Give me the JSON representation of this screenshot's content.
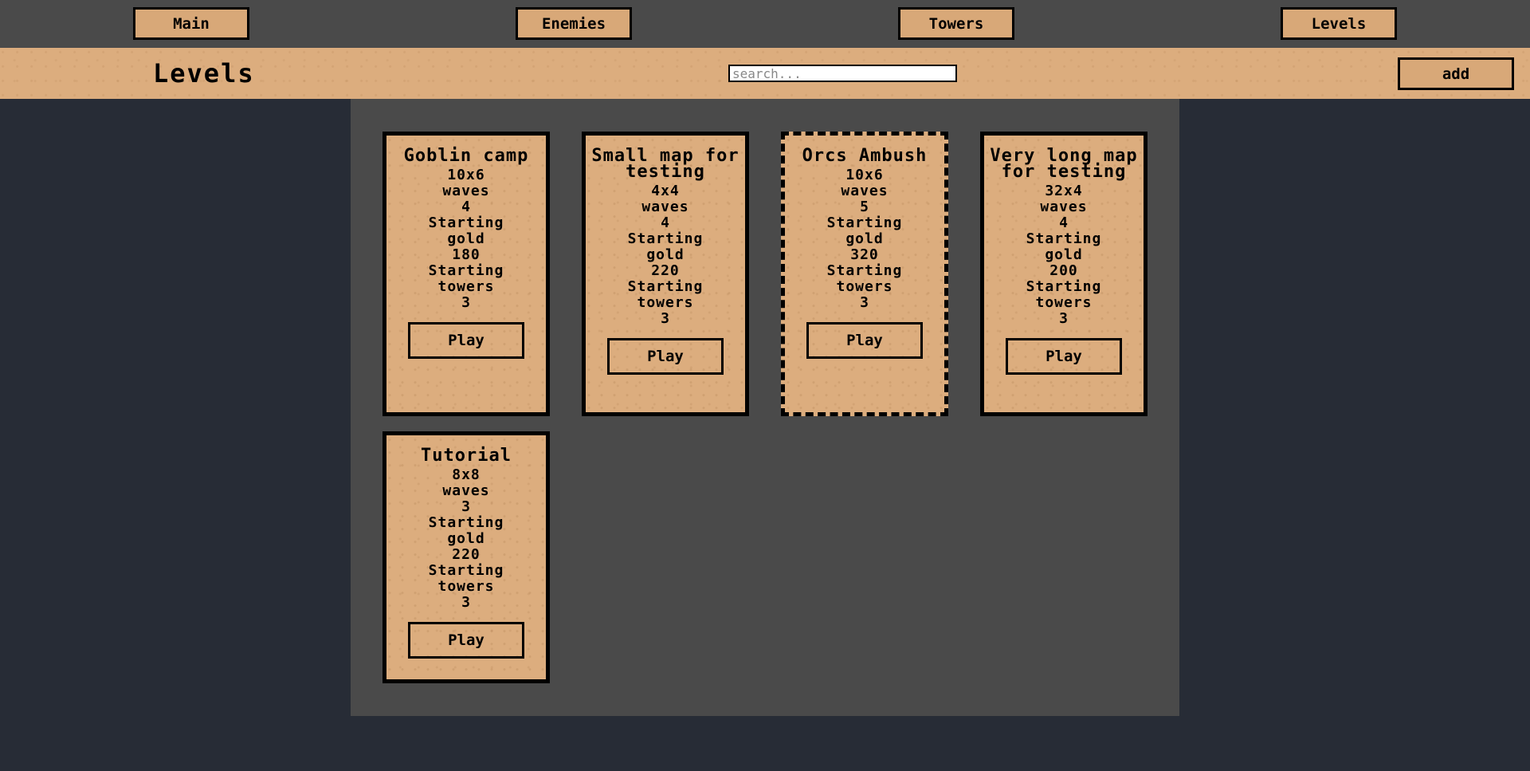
{
  "nav": {
    "items": [
      {
        "label": "Main"
      },
      {
        "label": "Enemies"
      },
      {
        "label": "Towers"
      },
      {
        "label": "Levels"
      }
    ]
  },
  "header": {
    "title": "Levels",
    "search_placeholder": "search...",
    "add_label": "add"
  },
  "levels": [
    {
      "name": "Goblin camp",
      "size": "10x6",
      "waves_label": "waves",
      "waves": "4",
      "gold_label1": "Starting",
      "gold_label2": "gold",
      "gold": "180",
      "towers_label1": "Starting",
      "towers_label2": "towers",
      "towers": "3",
      "play_label": "Play",
      "selected": false
    },
    {
      "name": "Small map for testing",
      "size": "4x4",
      "waves_label": "waves",
      "waves": "4",
      "gold_label1": "Starting",
      "gold_label2": "gold",
      "gold": "220",
      "towers_label1": "Starting",
      "towers_label2": "towers",
      "towers": "3",
      "play_label": "Play",
      "selected": false
    },
    {
      "name": "Orcs Ambush",
      "size": "10x6",
      "waves_label": "waves",
      "waves": "5",
      "gold_label1": "Starting",
      "gold_label2": "gold",
      "gold": "320",
      "towers_label1": "Starting",
      "towers_label2": "towers",
      "towers": "3",
      "play_label": "Play",
      "selected": true
    },
    {
      "name": "Very long map for testing",
      "size": "32x4",
      "waves_label": "waves",
      "waves": "4",
      "gold_label1": "Starting",
      "gold_label2": "gold",
      "gold": "200",
      "towers_label1": "Starting",
      "towers_label2": "towers",
      "towers": "3",
      "play_label": "Play",
      "selected": false
    },
    {
      "name": "Tutorial",
      "size": "8x8",
      "waves_label": "waves",
      "waves": "3",
      "gold_label1": "Starting",
      "gold_label2": "gold",
      "gold": "220",
      "towers_label1": "Starting",
      "towers_label2": "towers",
      "towers": "3",
      "play_label": "Play",
      "selected": false
    }
  ]
}
